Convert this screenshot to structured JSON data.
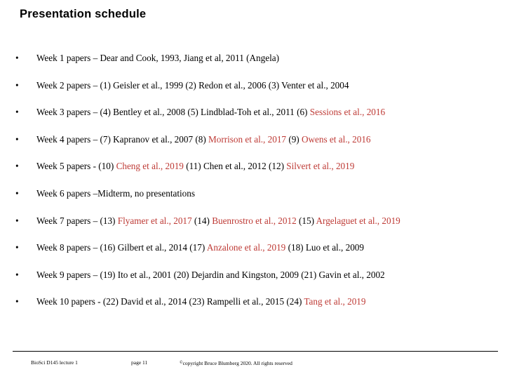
{
  "slide": {
    "title": "Presentation schedule",
    "bullet_marker": "•",
    "accent_red": "#BE3A35",
    "text_black": "#000000",
    "background": "#FFFFFF"
  },
  "bullets": [
    {
      "name": "week-1",
      "segments": [
        {
          "text": "Week 1 papers – Dear and Cook, 1993, Jiang et al, 2011 (Angela)",
          "color": "black"
        }
      ]
    },
    {
      "name": "week-2",
      "segments": [
        {
          "text": "Week 2 papers – (1) Geisler et al., 1999 (2) Redon et al., 2006 (3)  Venter et al., 2004",
          "color": "black"
        }
      ]
    },
    {
      "name": "week-3",
      "segments": [
        {
          "text": "Week 3 papers – (4) Bentley et al., 2008 (5)  Lindblad-Toh et al., 2011 (6) ",
          "color": "black"
        },
        {
          "text": "Sessions et al., 2016",
          "color": "red"
        }
      ]
    },
    {
      "name": "week-4",
      "segments": [
        {
          "text": "Week 4 papers – (7) Kapranov et al., 2007 (8) ",
          "color": "black"
        },
        {
          "text": "Morrison et al., 2017",
          "color": "red"
        },
        {
          "text": " (9) ",
          "color": "black"
        },
        {
          "text": "Owens et al., 2016",
          "color": "red"
        }
      ]
    },
    {
      "name": "week-5",
      "segments": [
        {
          "text": "Week 5 papers -  (10) ",
          "color": "black"
        },
        {
          "text": "Cheng et al., 2019",
          "color": "red"
        },
        {
          "text": " (11) Chen et al., 2012 (12) ",
          "color": "black"
        },
        {
          "text": "Silvert et al., 2019",
          "color": "red"
        }
      ]
    },
    {
      "name": "week-6",
      "segments": [
        {
          "text": "Week 6 papers –Midterm, no presentations",
          "color": "black"
        }
      ]
    },
    {
      "name": "week-7",
      "segments": [
        {
          "text": "Week 7 papers – (13) ",
          "color": "black"
        },
        {
          "text": "Flyamer et al., 2017",
          "color": "red"
        },
        {
          "text": " (14) ",
          "color": "black"
        },
        {
          "text": "Buenrostro et al., 2012",
          "color": "red"
        },
        {
          "text": " (15) ",
          "color": "black"
        },
        {
          "text": "Argelaguet et al., 2019",
          "color": "red"
        }
      ]
    },
    {
      "name": "week-8",
      "segments": [
        {
          "text": "Week 8 papers – (16) Gilbert et al., 2014 (17) ",
          "color": "black"
        },
        {
          "text": "Anzalone et al., 2019",
          "color": "red"
        },
        {
          "text": "  (18) Luo et al., 2009",
          "color": "black"
        }
      ]
    },
    {
      "name": "week-9",
      "segments": [
        {
          "text": "Week 9 papers – (19) Ito et al., 2001 (20) Dejardin and Kingston, 2009 (21) Gavin et al., 2002",
          "color": "black"
        }
      ]
    },
    {
      "name": "week-10",
      "segments": [
        {
          "text": "Week 10 papers - (22) David et al., 2014 (23)  Rampelli et al., 2015  (24) ",
          "color": "black"
        },
        {
          "text": "Tang et al., 2019",
          "color": "red"
        }
      ]
    }
  ],
  "footer": {
    "course": "BioSci D145 lecture 1",
    "page": "page 11",
    "copyright_mark": "©",
    "copyright": "copyright Bruce Blumberg 2020. All rights reserved"
  }
}
